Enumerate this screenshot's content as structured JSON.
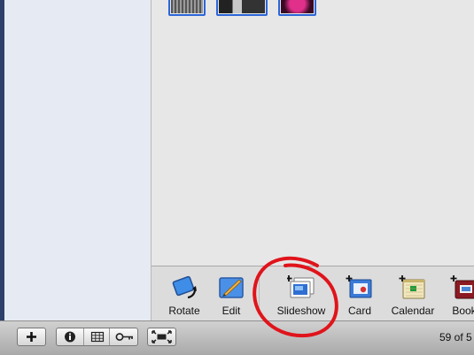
{
  "toolbar": {
    "rotate_label": "Rotate",
    "edit_label": "Edit",
    "slideshow_label": "Slideshow",
    "card_label": "Card",
    "calendar_label": "Calendar",
    "book_label": "Book"
  },
  "bottom_bar": {
    "add_icon": "plus-icon",
    "info_icon": "info-icon",
    "view_icon": "grid-icon",
    "keyword_icon": "key-icon",
    "fullscreen_icon": "fullscreen-icon",
    "photo_count": "59 of 5"
  },
  "annotation_color": "#e0141b",
  "accent_color": "#2c66d8"
}
